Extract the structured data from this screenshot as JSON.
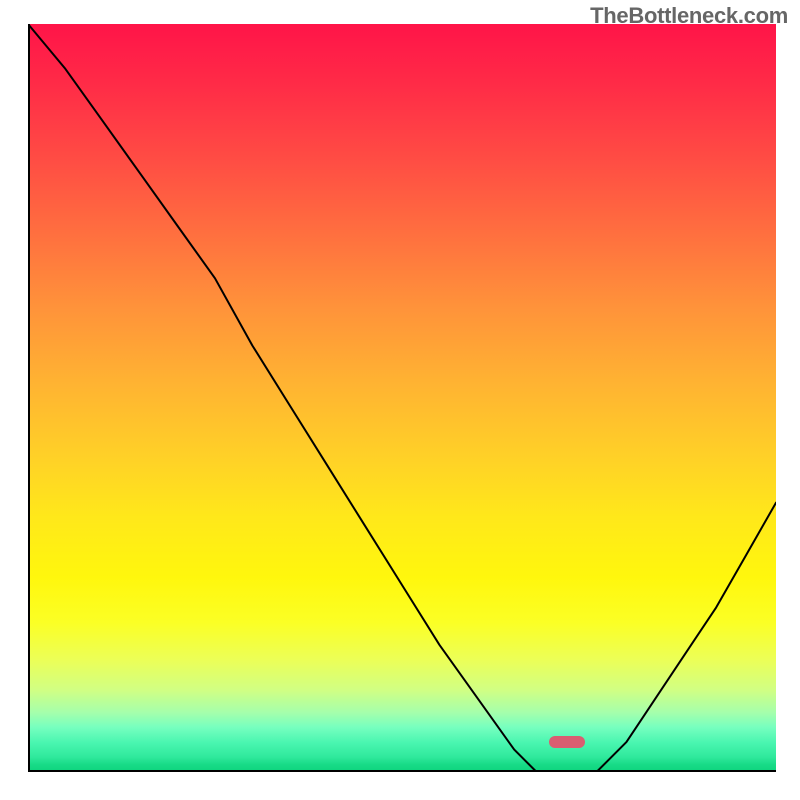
{
  "watermark": "TheBottleneck.com",
  "marker_x_position_fraction": 0.72,
  "chart_data": {
    "type": "line",
    "title": "",
    "xlabel": "",
    "ylabel": "",
    "xlim": [
      0,
      100
    ],
    "ylim": [
      0,
      100
    ],
    "x": [
      0,
      5,
      10,
      15,
      20,
      25,
      30,
      35,
      40,
      45,
      50,
      55,
      60,
      65,
      68,
      72,
      76,
      80,
      84,
      88,
      92,
      96,
      100
    ],
    "values": [
      100,
      94,
      87,
      80,
      73,
      66,
      57,
      49,
      41,
      33,
      25,
      17,
      10,
      3,
      0,
      0,
      0,
      4,
      10,
      16,
      22,
      29,
      36
    ],
    "notes": "The minimum of the curve corresponds to x ≈ 72% where the rounded marker sits. Background is a vertical gradient from red (high) through yellow to green (low)."
  }
}
